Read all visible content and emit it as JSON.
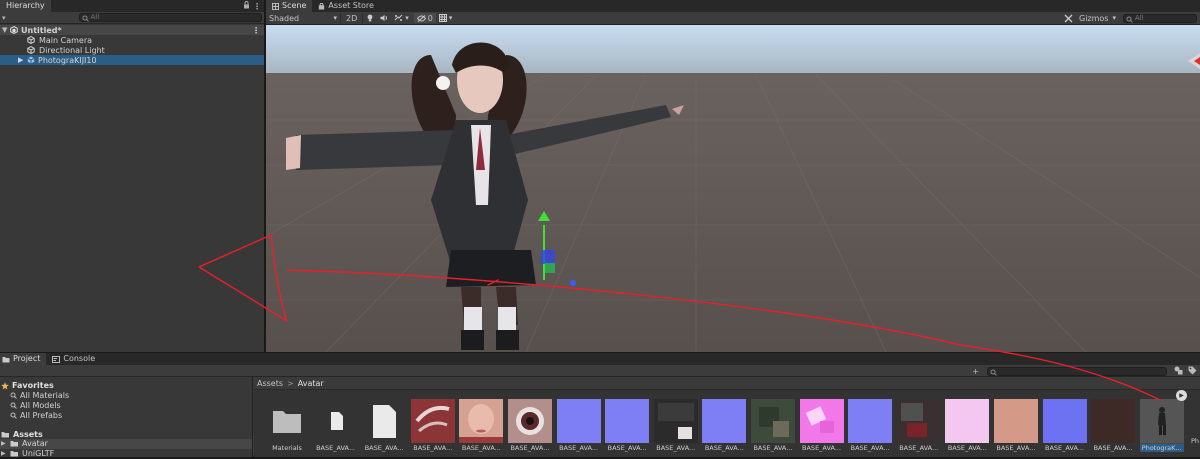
{
  "hierarchy": {
    "tab_label": "Hierarchy",
    "search_placeholder": "All",
    "scene_name": "Untitled*",
    "items": [
      {
        "label": "Main Camera"
      },
      {
        "label": "Directional Light"
      },
      {
        "label": "PhotograKIJI10"
      }
    ]
  },
  "scene": {
    "tabs": [
      {
        "label": "Scene"
      },
      {
        "label": "Asset Store"
      }
    ],
    "shading_mode": "Shaded",
    "mode_2d": "2D",
    "hidden_count": "0",
    "gizmos_label": "Gizmos",
    "search_placeholder": "All"
  },
  "project": {
    "tabs": [
      {
        "label": "Project"
      },
      {
        "label": "Console"
      }
    ],
    "favorites": {
      "label": "Favorites",
      "items": [
        {
          "label": "All Materials"
        },
        {
          "label": "All Models"
        },
        {
          "label": "All Prefabs"
        }
      ]
    },
    "assets": {
      "label": "Assets",
      "items": [
        {
          "label": "Avatar"
        },
        {
          "label": "UniGLTF"
        }
      ]
    },
    "breadcrumb": {
      "root": "Assets",
      "separator": ">",
      "current": "Avatar"
    },
    "grid": [
      {
        "label": "Materials",
        "kind": "folder"
      },
      {
        "label": "BASE_AVA...",
        "kind": "file"
      },
      {
        "label": "BASE_AVA...",
        "kind": "doc"
      },
      {
        "label": "BASE_AVA...",
        "kind": "tex-red"
      },
      {
        "label": "BASE_AVA...",
        "kind": "tex-face"
      },
      {
        "label": "BASE_AVA...",
        "kind": "tex-eye"
      },
      {
        "label": "BASE_AVA...",
        "kind": "tex-normal"
      },
      {
        "label": "BASE_AVA...",
        "kind": "tex-normal"
      },
      {
        "label": "BASE_AVA...",
        "kind": "tex-dark"
      },
      {
        "label": "BASE_AVA...",
        "kind": "tex-normal"
      },
      {
        "label": "BASE_AVA...",
        "kind": "tex-green"
      },
      {
        "label": "BASE_AVA...",
        "kind": "tex-pink"
      },
      {
        "label": "BASE_AVA...",
        "kind": "tex-normal"
      },
      {
        "label": "BASE_AVA...",
        "kind": "tex-darkred"
      },
      {
        "label": "BASE_AVA...",
        "kind": "tex-lightpink"
      },
      {
        "label": "BASE_AVA...",
        "kind": "tex-skin"
      },
      {
        "label": "BASE_AVA...",
        "kind": "tex-noise"
      },
      {
        "label": "BASE_AVA...",
        "kind": "tex-maroon"
      },
      {
        "label": "PhotograK...",
        "kind": "prefab"
      }
    ],
    "cutoff_label": "Ph"
  },
  "colors": {
    "selection": "#2c5d87",
    "annotation": "#e8202a"
  }
}
